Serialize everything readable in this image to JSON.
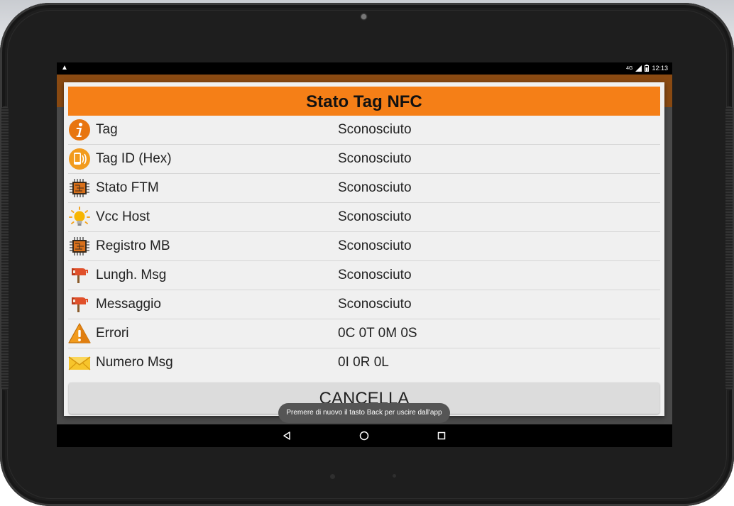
{
  "status_bar": {
    "time": "12:13",
    "network": "4G"
  },
  "dialog": {
    "title": "Stato Tag NFC",
    "rows": [
      {
        "icon": "info-icon",
        "label": "Tag",
        "value": "Sconosciuto"
      },
      {
        "icon": "nfc-phone-icon",
        "label": "Tag ID (Hex)",
        "value": "Sconosciuto"
      },
      {
        "icon": "chip-icon",
        "label": "Stato FTM",
        "value": "Sconosciuto"
      },
      {
        "icon": "lightbulb-icon",
        "label": "Vcc Host",
        "value": "Sconosciuto"
      },
      {
        "icon": "chip-icon",
        "label": "Registro MB",
        "value": "Sconosciuto"
      },
      {
        "icon": "mailbox-icon",
        "label": "Lungh. Msg",
        "value": "Sconosciuto"
      },
      {
        "icon": "mailbox-icon",
        "label": "Messaggio",
        "value": "Sconosciuto"
      },
      {
        "icon": "warning-icon",
        "label": "Errori",
        "value": "0C 0T 0M 0S"
      },
      {
        "icon": "envelope-icon",
        "label": "Numero Msg",
        "value": "0I 0R 0L"
      }
    ],
    "cancel_label": "CANCELLA"
  },
  "toast": {
    "text": "Premere di nuovo il tasto Back per uscire dall'app"
  },
  "colors": {
    "title_bar": "#f57f17",
    "app_bar": "#8a4a12",
    "dialog_bg": "#f0f0f0"
  }
}
